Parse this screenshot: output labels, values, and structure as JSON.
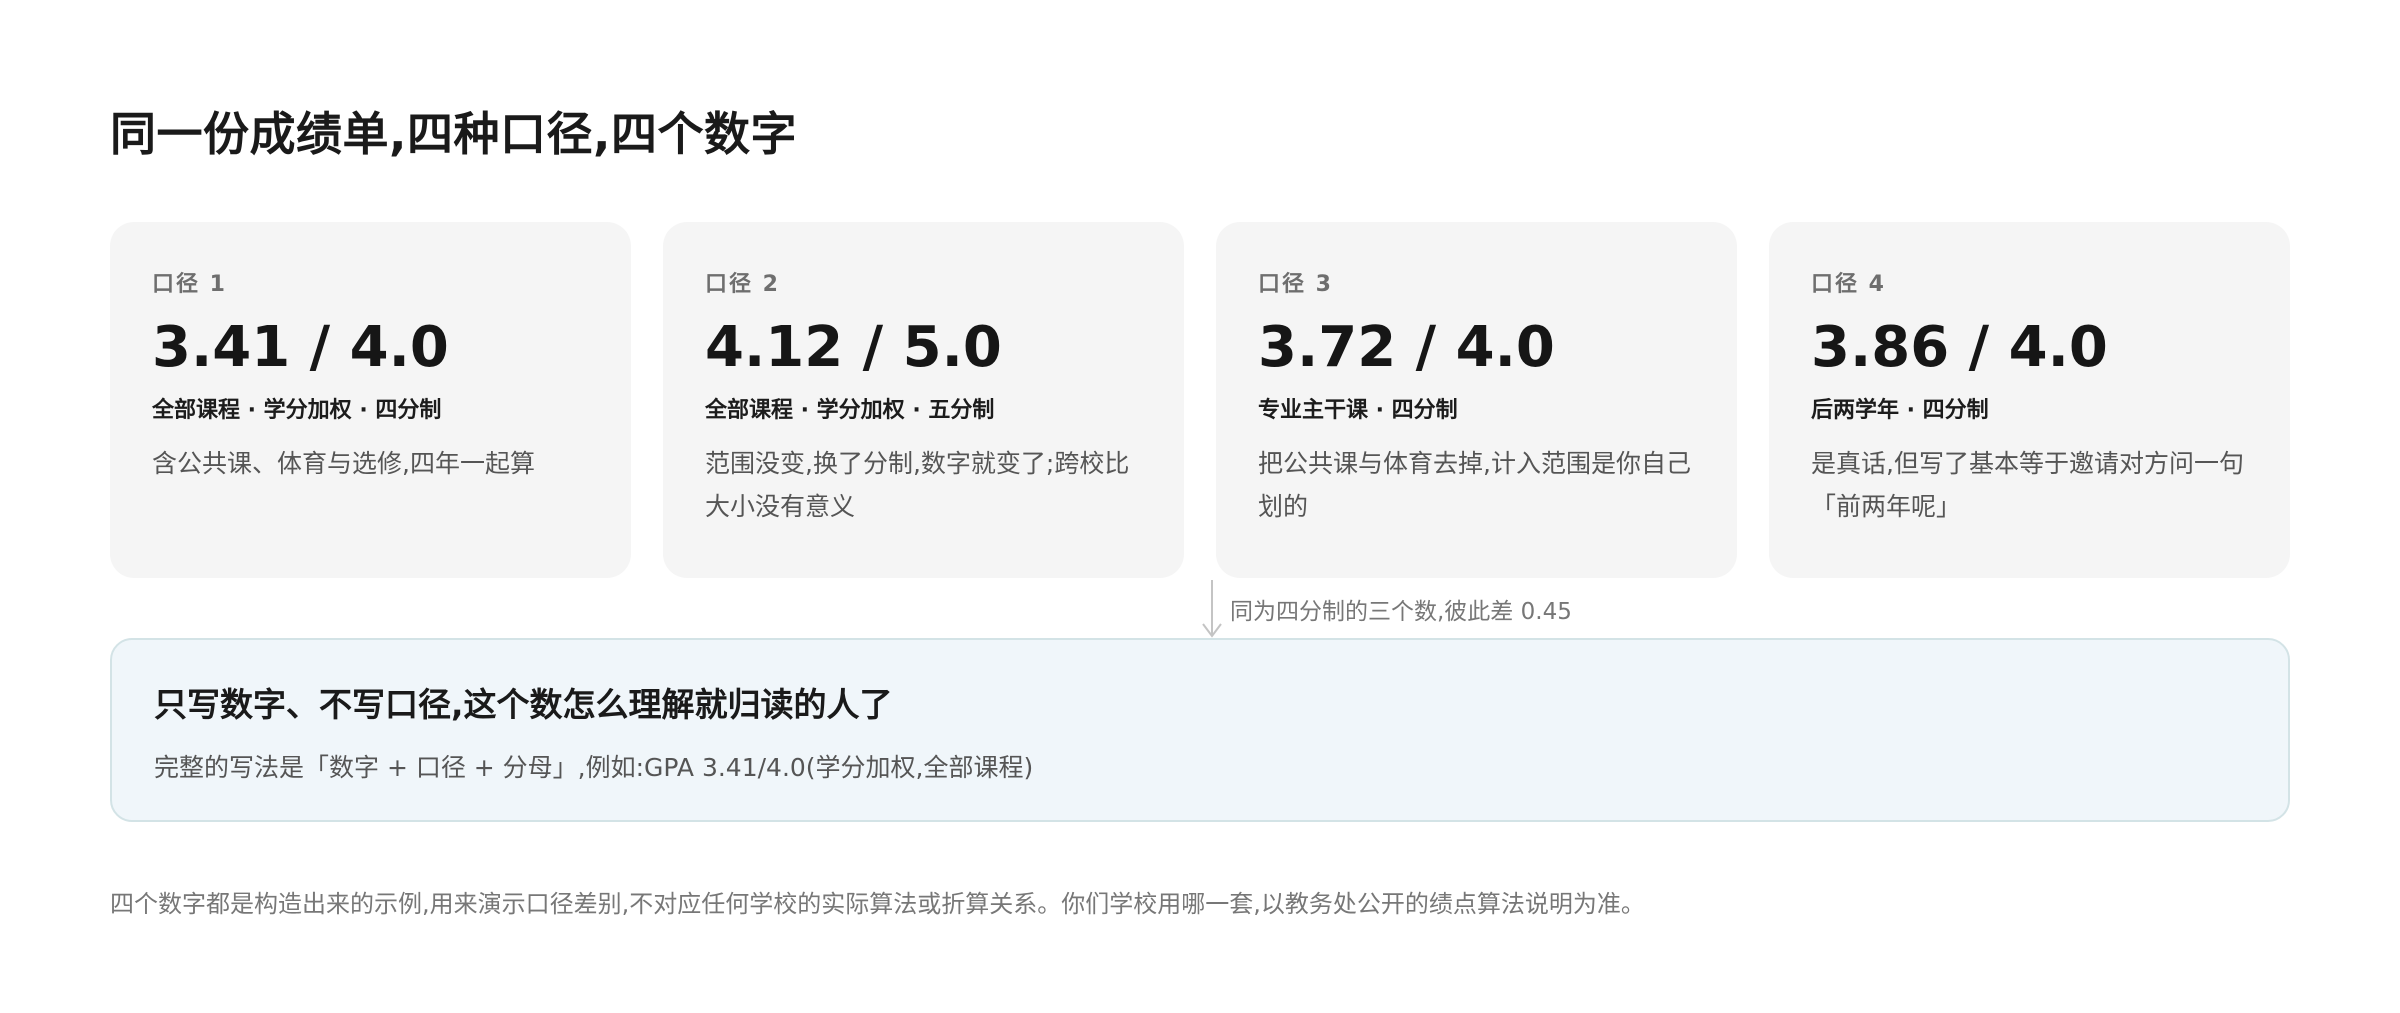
{
  "title": "同一份成绩单,四种口径,四个数字",
  "cards": [
    {
      "label": "口径 1",
      "value": "3.41 / 4.0",
      "tags": "全部课程 · 学分加权 · 四分制",
      "description": "含公共课、体育与选修,四年一起算"
    },
    {
      "label": "口径 2",
      "value": "4.12 / 5.0",
      "tags": "全部课程 · 学分加权 · 五分制",
      "description": "范围没变,换了分制,数字就变了;跨校比大小没有意义"
    },
    {
      "label": "口径 3",
      "value": "3.72 / 4.0",
      "tags": "专业主干课 · 四分制",
      "description": "把公共课与体育去掉,计入范围是你自己划的"
    },
    {
      "label": "口径 4",
      "value": "3.86 / 4.0",
      "tags": "后两学年 · 四分制",
      "description": "是真话,但写了基本等于邀请对方问一句「前两年呢」"
    }
  ],
  "connector": {
    "note": "同为四分制的三个数,彼此差 0.45",
    "icon": "down-arrow-icon"
  },
  "callout": {
    "title": "只写数字、不写口径,这个数怎么理解就归读的人了",
    "body": "完整的写法是「数字 + 口径 + 分母」,例如:GPA 3.41/4.0(学分加权,全部课程)"
  },
  "footnote": "四个数字都是构造出来的示例,用来演示口径差别,不对应任何学校的实际算法或折算关系。你们学校用哪一套,以教务处公开的绩点算法说明为准。",
  "colors": {
    "card_background": "#f5f5f5",
    "callout_background": "#f0f6fa",
    "callout_border": "#d3e3e6",
    "muted_text": "#777777"
  }
}
